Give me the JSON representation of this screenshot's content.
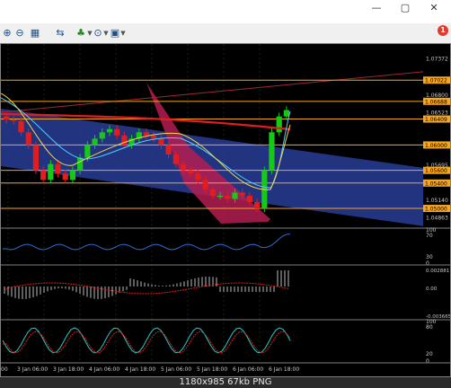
{
  "window": {
    "minimize": "—",
    "maximize": "▢",
    "close": "✕"
  },
  "toolbar": {
    "zoom_in": "⊕",
    "zoom_out": "⊖",
    "tile": "▦",
    "chart_props": "⇆",
    "indicators": "♣",
    "dropdown": "▼",
    "clock": "⊙",
    "templates": "▣",
    "notification_count": "1"
  },
  "colors": {
    "background": "#000000",
    "grid": "#1d3b1d",
    "bull": "#17c917",
    "bear": "#e21d1d",
    "level": "#f5a623",
    "channel": "#283c96",
    "fan": "#aa1b4b"
  },
  "chart_data": {
    "type": "candlestick",
    "x_ticks": [
      "3 Jan 06:00",
      "3 Jan 18:00",
      "4 Jan 06:00",
      "4 Jan 18:00",
      "5 Jan 06:00",
      "5 Jan 18:00",
      "6 Jan 06:00",
      "6 Jan 18:00"
    ],
    "first_tick_fragment": "00",
    "price_ticks": [
      "1.07372",
      "1.06800",
      "1.06523",
      "1.05695",
      "1.05140",
      "1.04863"
    ],
    "price_labels_highlight": [
      "1.07022",
      "1.06688",
      "1.06409",
      "1.06000",
      "1.05600",
      "1.05400",
      "1.05000"
    ],
    "level_lines": [
      1.07022,
      1.06688,
      1.06409,
      1.06,
      1.056,
      1.054,
      1.05
    ],
    "price_range": [
      1.0476,
      1.0745
    ],
    "candles_close_path": [
      1.064,
      1.0638,
      1.062,
      1.06,
      1.056,
      1.0545,
      1.057,
      1.0555,
      1.0545,
      1.056,
      1.058,
      1.06,
      1.061,
      1.062,
      1.0625,
      1.0615,
      1.06,
      1.061,
      1.062,
      1.0615,
      1.061,
      1.06,
      1.0585,
      1.057,
      1.056,
      1.0555,
      1.0545,
      1.053,
      1.052,
      1.052,
      1.0515,
      1.0525,
      1.052,
      1.051,
      1.05,
      1.056,
      1.062,
      1.0645,
      1.0655
    ],
    "rsi_panel": {
      "ticks": [
        "100",
        "70",
        "30",
        "0"
      ]
    },
    "macd_panel": {
      "ticks": [
        "0.002881",
        "0.00",
        "-0.003665"
      ]
    },
    "stoch_panel": {
      "ticks": [
        "100",
        "80",
        "20",
        "0"
      ]
    }
  },
  "status": {
    "text": "1180x985  67kb  PNG"
  }
}
